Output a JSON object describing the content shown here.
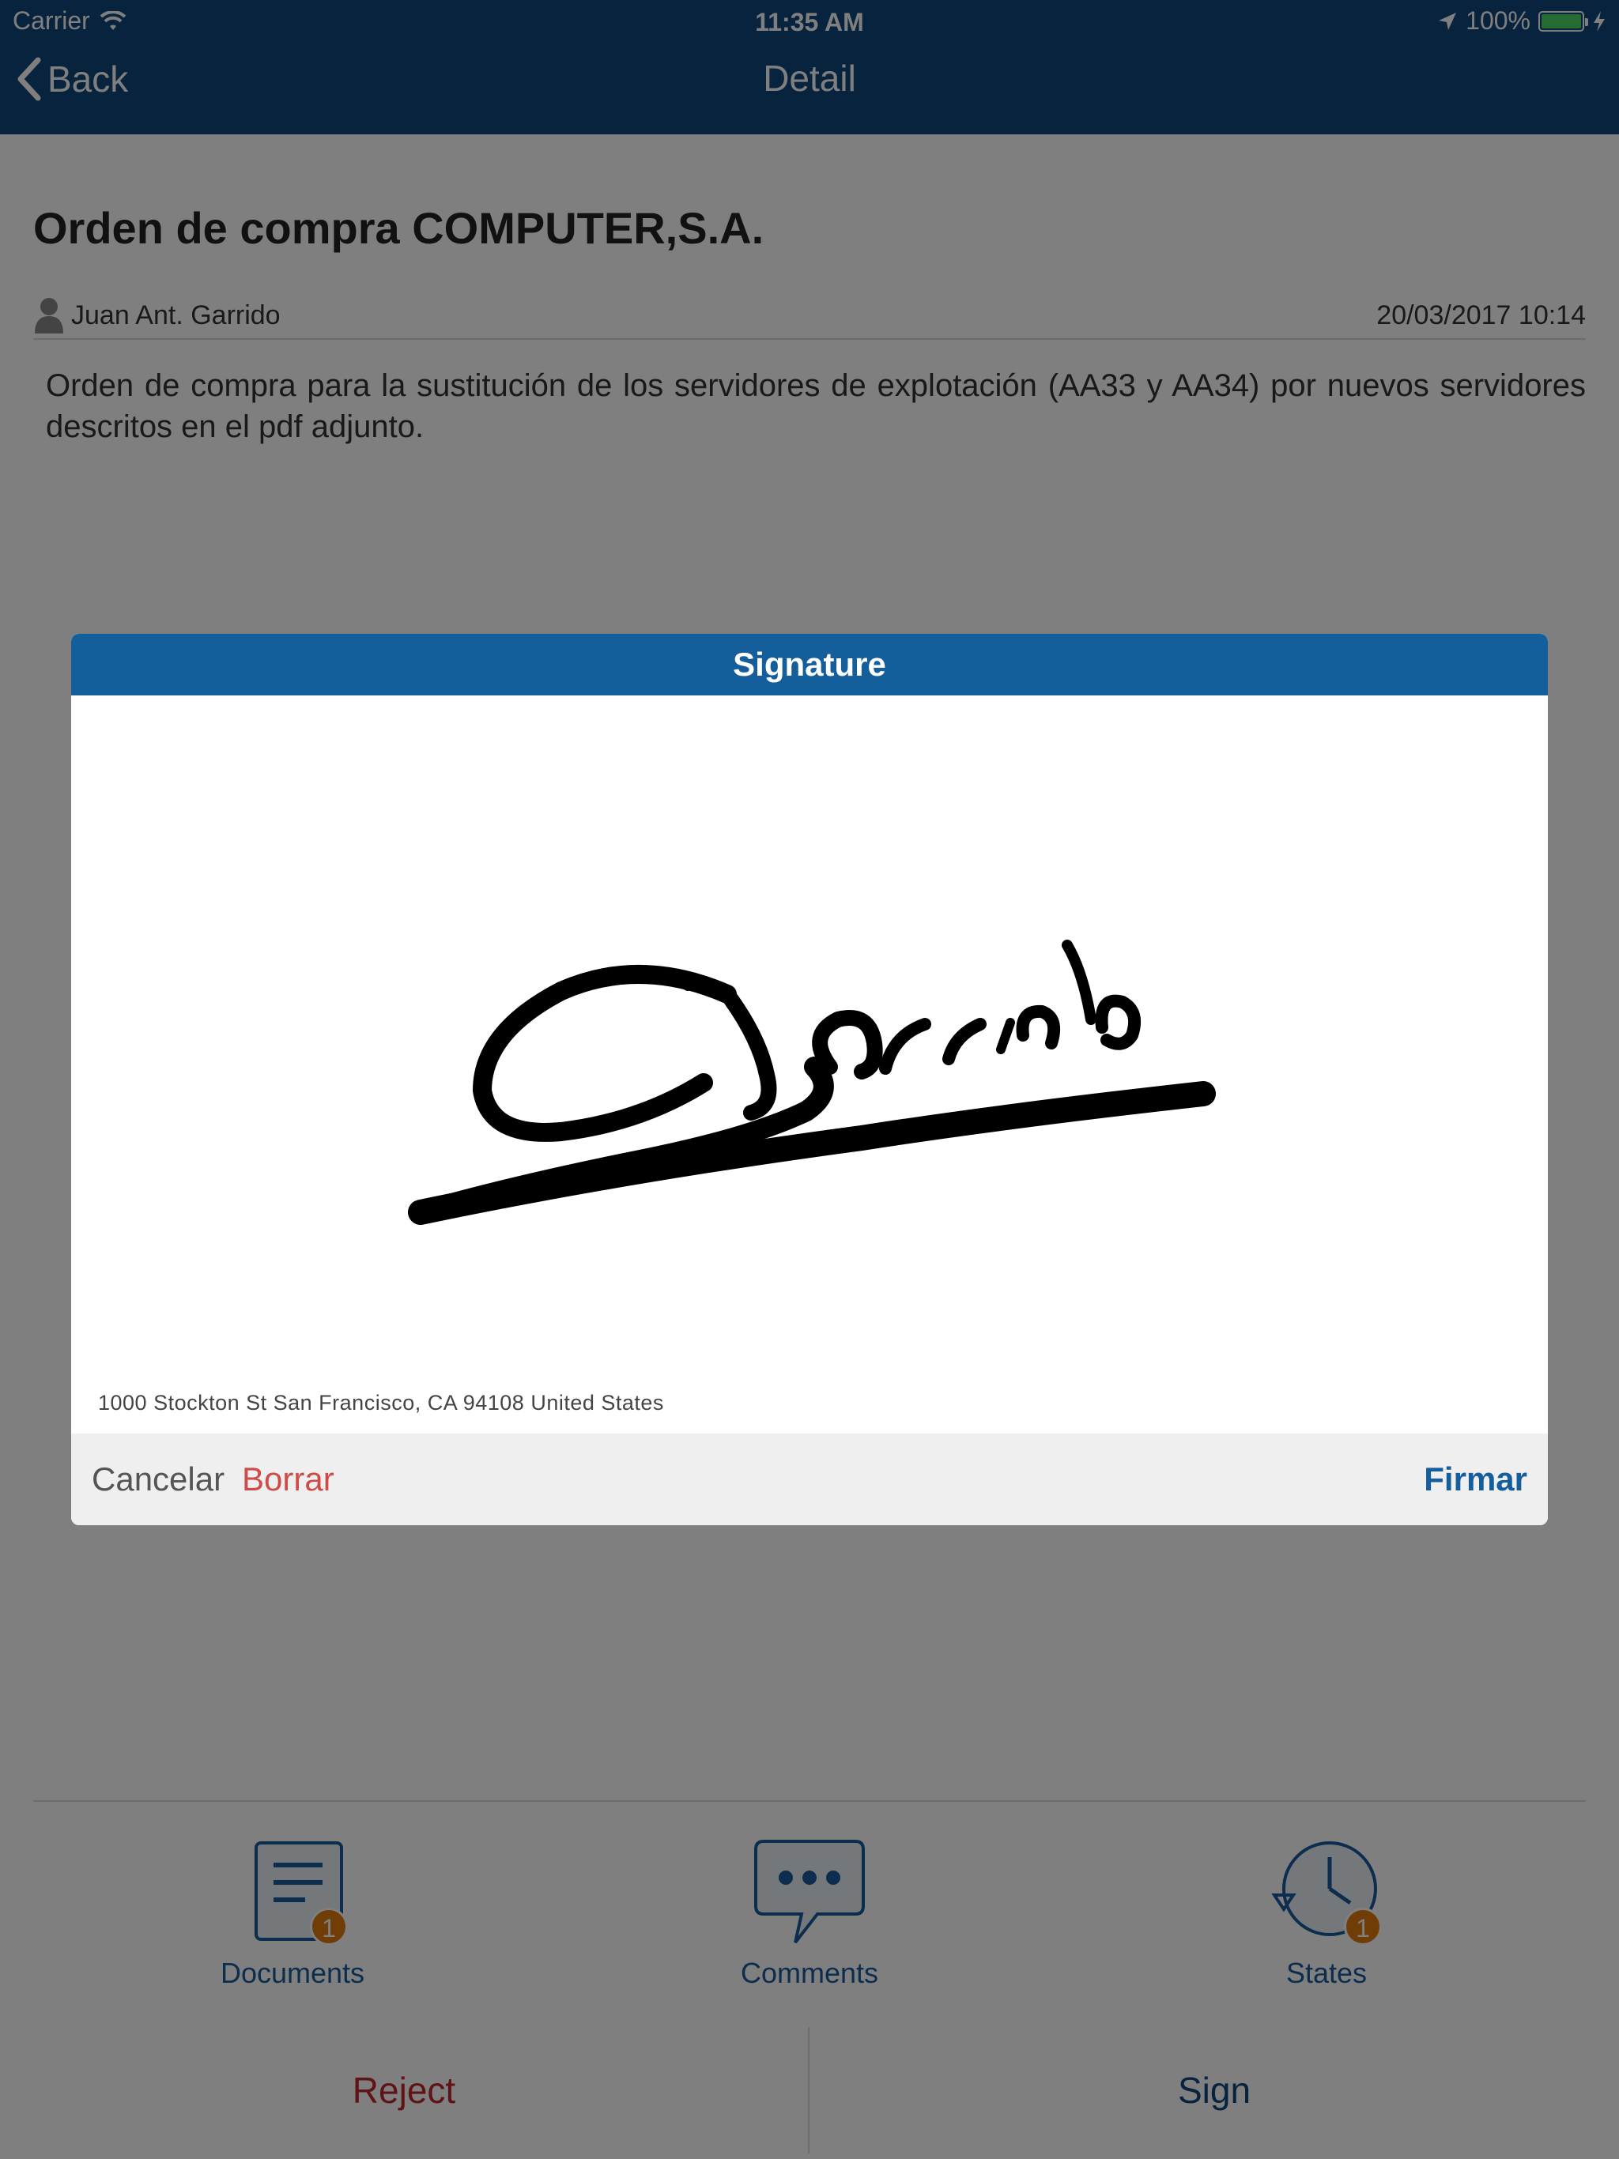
{
  "status_bar": {
    "carrier": "Carrier",
    "time": "11:35 AM",
    "battery": "100%",
    "icons": [
      "wifi-icon",
      "location-arrow-icon",
      "battery-icon",
      "charging-bolt-icon"
    ]
  },
  "navbar": {
    "back_label": "Back",
    "title": "Detail"
  },
  "document": {
    "title": "Orden de compra COMPUTER,S.A.",
    "author": "Juan Ant. Garrido",
    "date": "20/03/2017 10:14",
    "description": "Orden de compra para la sustitución de los servidores de explotación (AA33 y AA34) por nuevos servidores descritos en el pdf adjunto."
  },
  "tabs": [
    {
      "label": "Documents",
      "icon": "document-icon",
      "badge": "1"
    },
    {
      "label": "Comments",
      "icon": "comment-bubble-icon",
      "badge": ""
    },
    {
      "label": "States",
      "icon": "history-clock-icon",
      "badge": "1"
    }
  ],
  "actions": {
    "reject_label": "Reject",
    "sign_label": "Sign"
  },
  "signature_dialog": {
    "title": "Signature",
    "location": "1000 Stockton St San Francisco, CA  94108 United States",
    "cancel_label": "Cancelar",
    "clear_label": "Borrar",
    "confirm_label": "Firmar",
    "signature_text": "Garrido"
  },
  "colors": {
    "navbar": "#10467d",
    "dialog_header": "#155e9c",
    "reject": "#c0272d",
    "clear": "#d04a48",
    "badge": "#e07b0c"
  }
}
